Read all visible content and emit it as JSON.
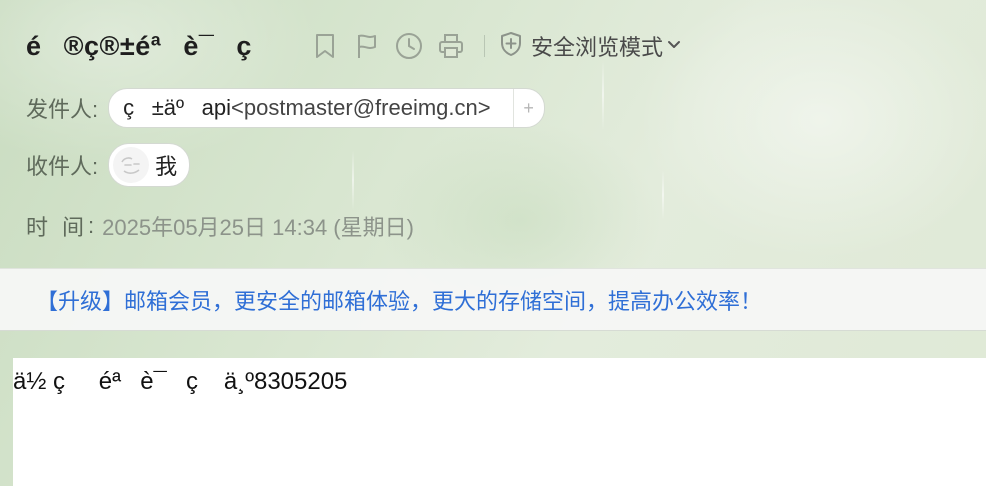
{
  "header": {
    "subject": "é®ç®±éªè¯ç "
  },
  "toolbar": {
    "icons": [
      "bookmark-icon",
      "flag-icon",
      "clock-icon",
      "print-icon"
    ],
    "safe_mode_label": "安全浏览模式"
  },
  "meta": {
    "from_label": "发件人:",
    "from_name": "ç±äºapi",
    "from_address": "<postmaster@freeimg.cn>",
    "add_contact": "+",
    "to_label": "收件人:",
    "to_name": "我",
    "time_label": "时间",
    "time_colon": ":",
    "time_value": "2025年05月25日 14:34 (星期日)"
  },
  "banner": {
    "text": "【升级】邮箱会员，更安全的邮箱体验，更大的存储空间，提高办公效率！"
  },
  "body": {
    "text": "ä½ çéªè¯ç ä¸º8305205"
  },
  "colors": {
    "banner_link": "#2f6fd6",
    "subject": "#1e1e1e",
    "meta_label": "#5f6a5b",
    "time_value": "#8c938a"
  }
}
